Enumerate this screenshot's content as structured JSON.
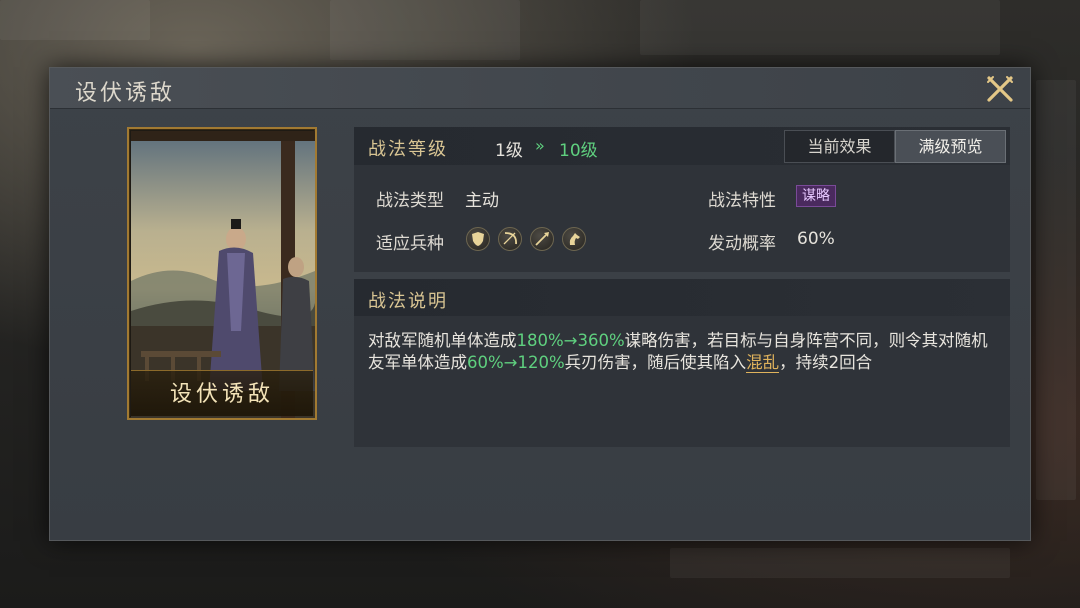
{
  "dialog": {
    "title": "设伏诱敌"
  },
  "card": {
    "name": "设伏诱敌"
  },
  "level": {
    "label": "战法等级",
    "from": "1级",
    "arrow": "»",
    "to": "10级"
  },
  "tabs": [
    {
      "label": "当前效果",
      "selected": false
    },
    {
      "label": "满级预览",
      "selected": true
    }
  ],
  "attributes": {
    "type_label": "战法类型",
    "type_value": "主动",
    "trait_label": "战法特性",
    "trait_value": "谋略",
    "units_label": "适应兵种",
    "units": [
      "shield-icon",
      "bow-icon",
      "spear-icon",
      "horse-icon"
    ],
    "chance_label": "发动概率",
    "chance_value": "60%"
  },
  "description": {
    "label": "战法说明",
    "part1": "对敌军随机单体造成",
    "value1": "180%→360%",
    "part2": "谋略伤害，若目标与自身阵营不同，则令其对随机友军单体造成",
    "value2": "60%→120%",
    "part3": "兵刃伤害，随后使其陷入",
    "status": "混乱",
    "part4": "，持续2回合"
  },
  "colors": {
    "accent_gold": "#d9c593",
    "upgrade_green": "#5fd07f",
    "trait_purple": "#4a2a5e",
    "status_gold": "#e0b35c"
  }
}
